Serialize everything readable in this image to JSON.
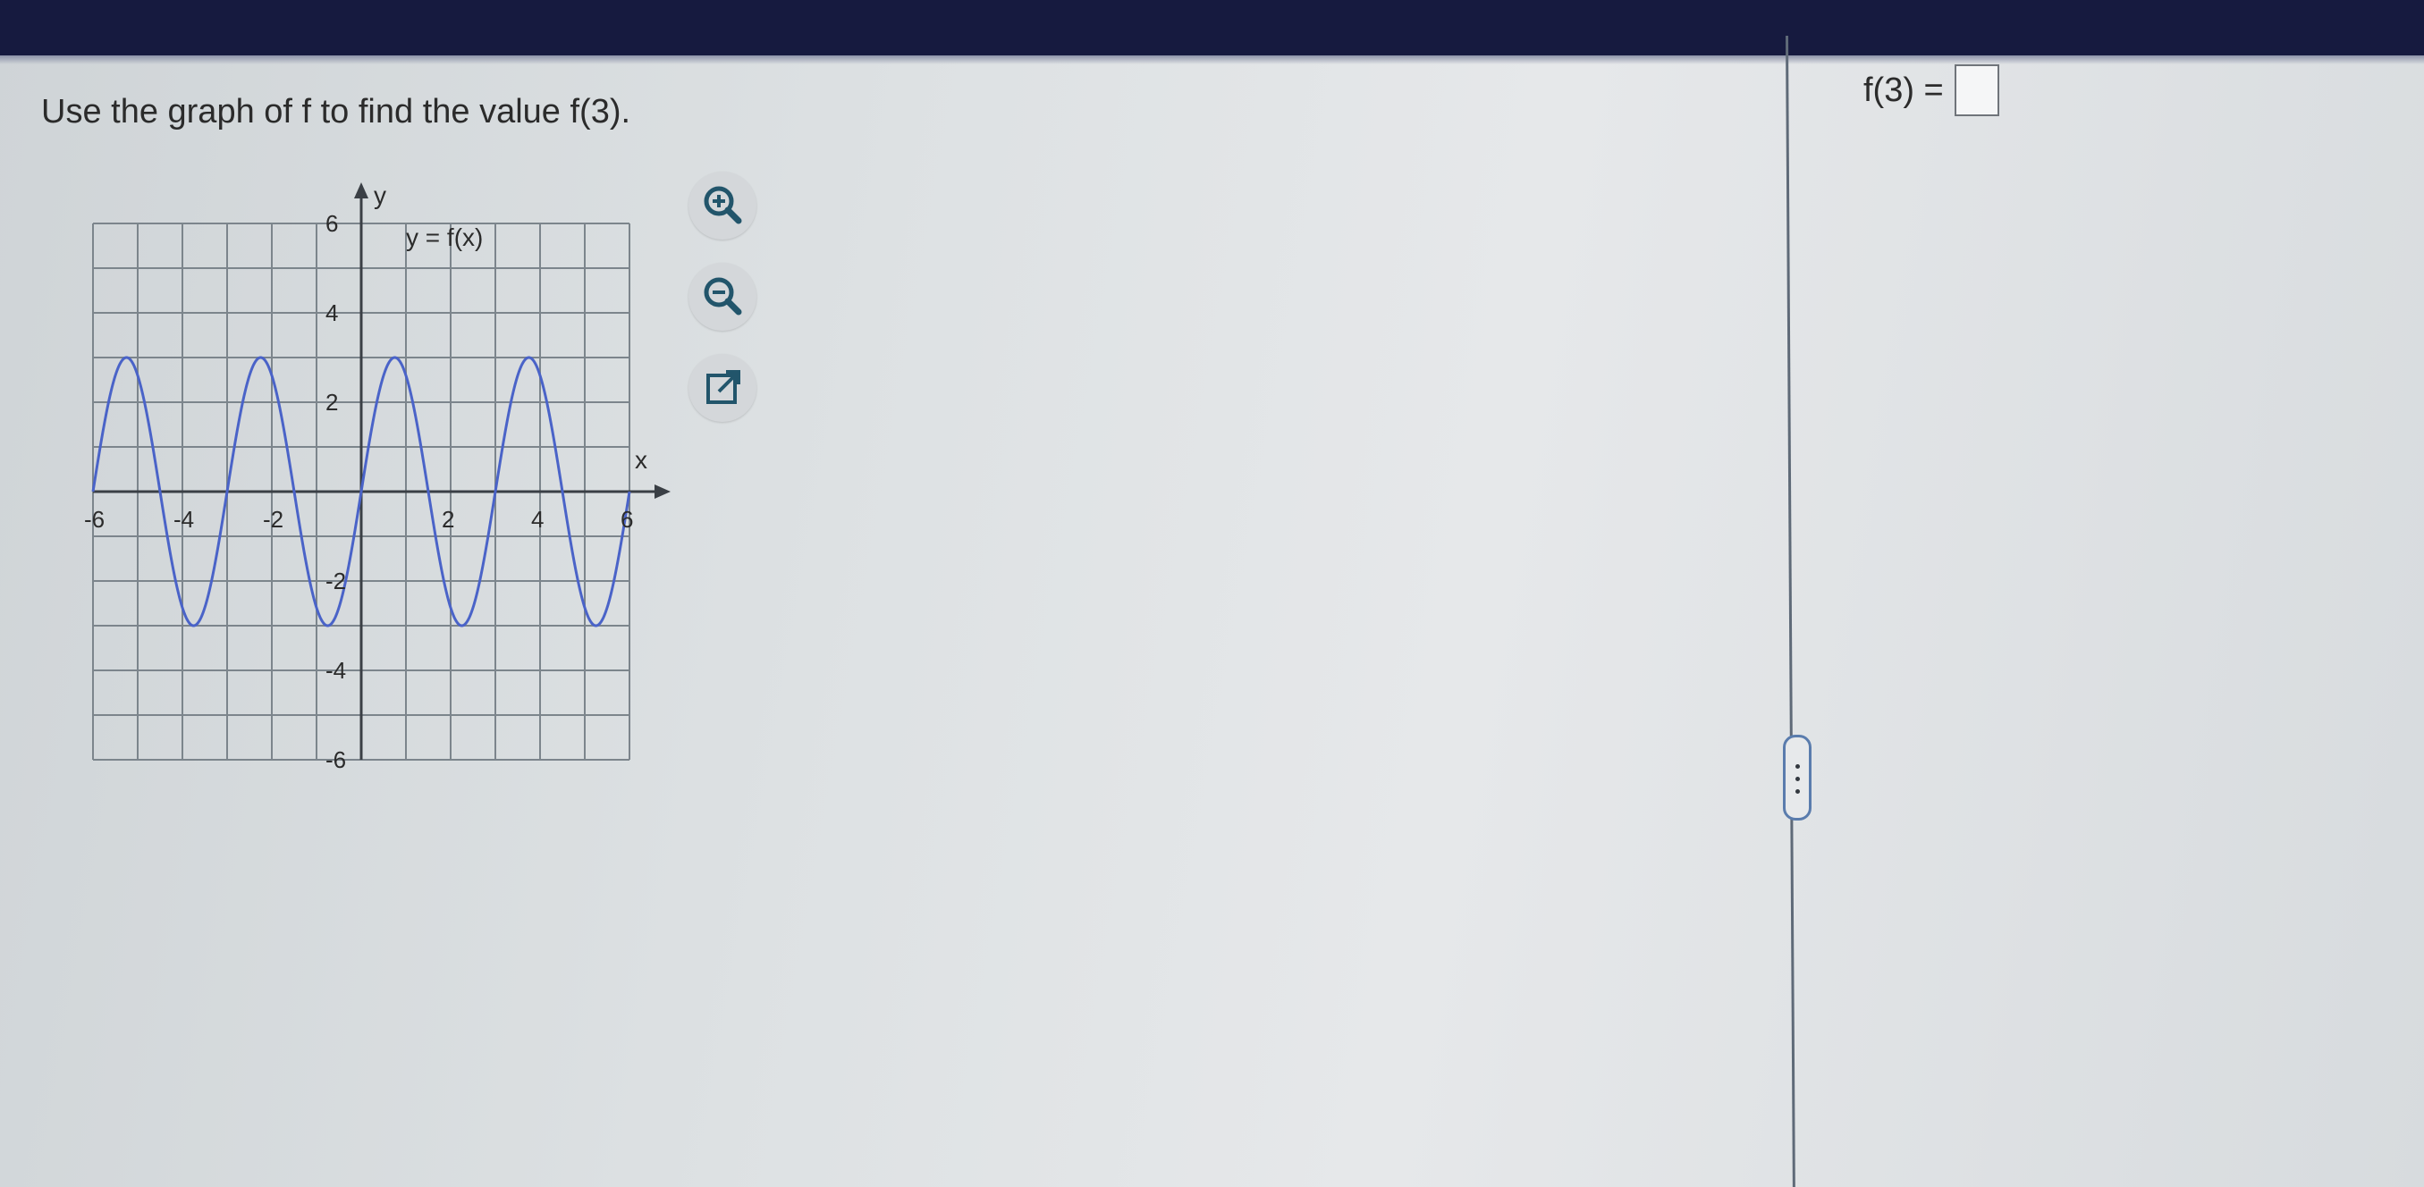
{
  "question": {
    "text": "Use the graph of f to find the value f(3)."
  },
  "graph": {
    "curve_label": "y = f(x)",
    "x_axis_label": "x",
    "y_axis_label": "y",
    "x_tick_labels": [
      "-6",
      "-4",
      "-2",
      "2",
      "4",
      "6"
    ],
    "y_tick_labels": [
      "6",
      "4",
      "2",
      "-2",
      "-4",
      "-6"
    ],
    "x_range": [
      -6,
      6
    ],
    "y_range": [
      -6,
      6
    ],
    "curve_color": "#4a63c8"
  },
  "tools": {
    "zoom_in": "zoom-in-icon",
    "zoom_out": "zoom-out-icon",
    "pop_out": "pop-out-icon"
  },
  "answer": {
    "label": "f(3) =",
    "value": ""
  },
  "colors": {
    "top_bar": "#161a3f",
    "grid_line": "#7c858c",
    "curve": "#4a63c8"
  }
}
